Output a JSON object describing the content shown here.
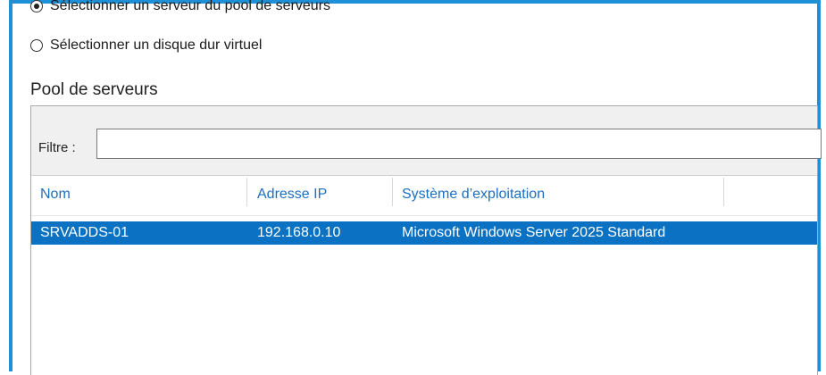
{
  "options": {
    "opt1": {
      "label": "Sélectionner un serveur du pool de serveurs",
      "selected": true
    },
    "opt2": {
      "label": "Sélectionner un disque dur virtuel",
      "selected": false
    }
  },
  "pool": {
    "title": "Pool de serveurs",
    "filter_label": "Filtre :",
    "filter_value": "",
    "columns": [
      "Nom",
      "Adresse IP",
      "Système d’exploitation"
    ],
    "rows": [
      {
        "name": "SRVADDS-01",
        "ip": "192.168.0.10",
        "os": "Microsoft Windows Server 2025 Standard",
        "selected": true
      }
    ]
  },
  "colors": {
    "accent": "#1e90d8",
    "selection": "#0b71c2",
    "header_text": "#1a6fc2"
  }
}
